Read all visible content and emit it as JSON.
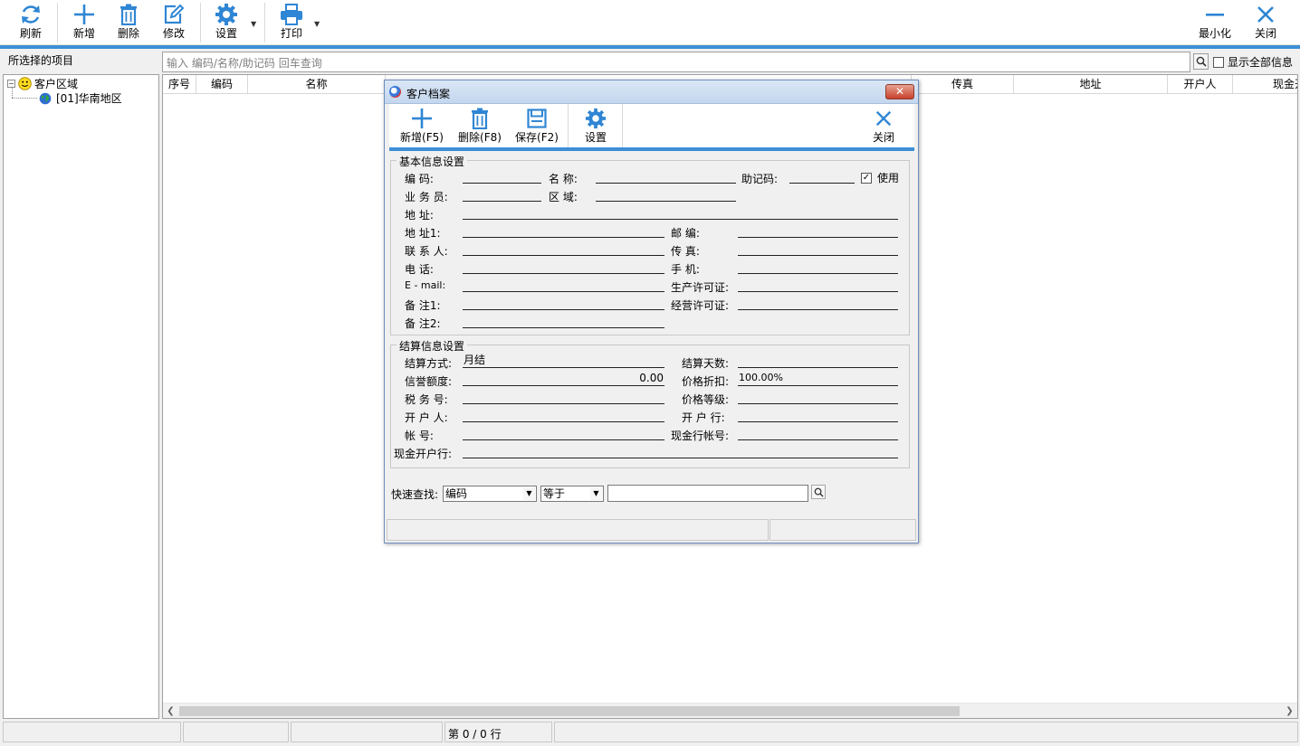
{
  "toolbar": {
    "refresh": "刷新",
    "add": "新增",
    "delete": "删除",
    "edit": "修改",
    "settings": "设置",
    "print": "打印",
    "minimize": "最小化",
    "close": "关闭"
  },
  "left_panel": {
    "header": "所选择的项目",
    "tree": {
      "root": "客户区域",
      "child": "[01]华南地区"
    }
  },
  "search": {
    "placeholder": "输入 编码/名称/助记码 回车查询",
    "show_all_label": "显示全部信息"
  },
  "grid": {
    "columns_left": [
      "序号",
      "编码",
      "名称"
    ],
    "columns_right": [
      "传真",
      "地址",
      "开户人",
      "现金开"
    ]
  },
  "statusbar": {
    "row_info": "第 0 / 0 行"
  },
  "dialog": {
    "title": "客户档案",
    "toolbar": {
      "add": "新增(F5)",
      "delete": "删除(F8)",
      "save": "保存(F2)",
      "settings": "设置",
      "close": "关闭"
    },
    "basic": {
      "legend": "基本信息设置",
      "code": "编    码:",
      "name": "名  称:",
      "mnemonic": "助记码:",
      "enabled_label": "使用",
      "salesperson": "业 务 员:",
      "region": "区  域:",
      "address": "地    址:",
      "address1": "地    址1:",
      "zipcode": "邮      编:",
      "contact": "联 系 人:",
      "fax": "传      真:",
      "phone": "电    话:",
      "mobile": "手      机:",
      "email": "E - mail:",
      "production_license": "生产许可证:",
      "remark1": "备    注1:",
      "business_license": "经营许可证:",
      "remark2": "备    注2:"
    },
    "settlement": {
      "legend": "结算信息设置",
      "method_label": "结算方式:",
      "method_value": "月结",
      "days_label": "结算天数:",
      "credit_label": "信誉额度:",
      "credit_value": "0.00",
      "discount_label": "价格折扣:",
      "discount_value": "100.00%",
      "tax_label": "税 务 号:",
      "price_level_label": "价格等级:",
      "account_holder_label": "开 户 人:",
      "bank_label": "开 户 行:",
      "account_label": "帐    号:",
      "cash_account_label": "现金行帐号:",
      "cash_bank_label": "现金开户行:"
    },
    "quick_search": {
      "label": "快速查找:",
      "field_value": "编码",
      "op_value": "等于"
    }
  }
}
